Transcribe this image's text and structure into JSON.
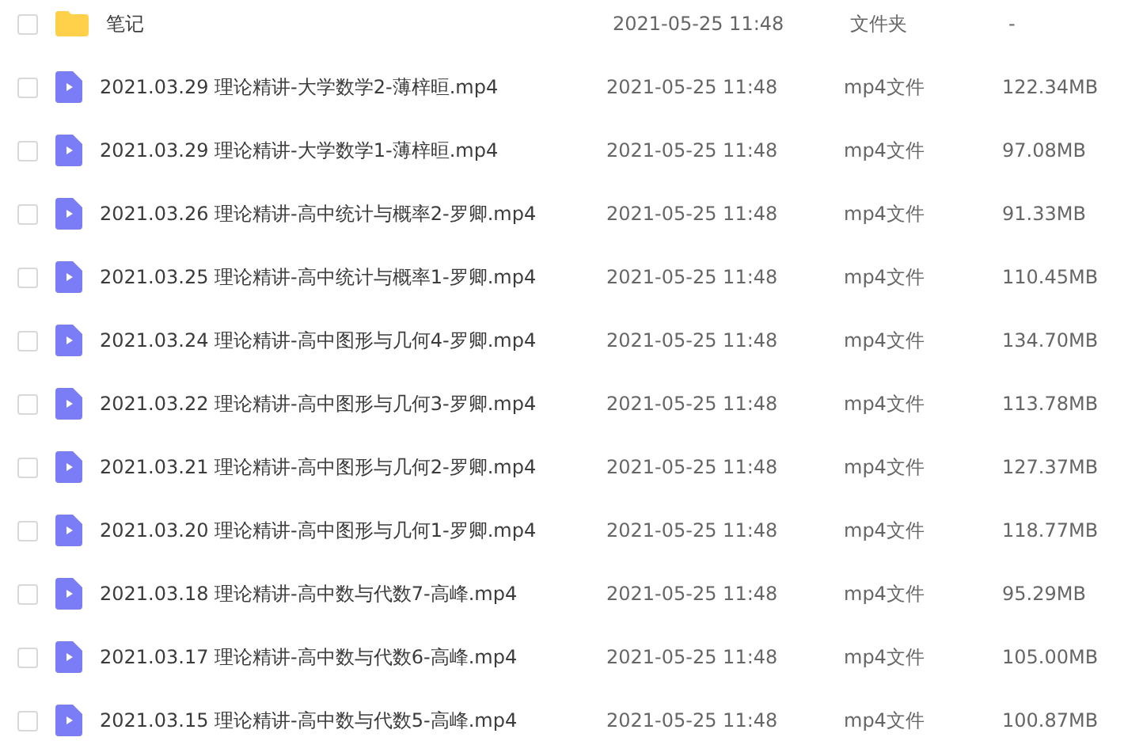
{
  "files": [
    {
      "kind": "folder",
      "checked": false,
      "name": "笔记",
      "modified": "2021-05-25 11:48",
      "type": "文件夹",
      "size": "-"
    },
    {
      "kind": "video",
      "checked": false,
      "name": "2021.03.29 理论精讲-大学数学2-薄梓晅.mp4",
      "modified": "2021-05-25 11:48",
      "type": "mp4文件",
      "size": "122.34MB"
    },
    {
      "kind": "video",
      "checked": false,
      "name": "2021.03.29 理论精讲-大学数学1-薄梓晅.mp4",
      "modified": "2021-05-25 11:48",
      "type": "mp4文件",
      "size": "97.08MB"
    },
    {
      "kind": "video",
      "checked": false,
      "name": "2021.03.26 理论精讲-高中统计与概率2-罗卿.mp4",
      "modified": "2021-05-25 11:48",
      "type": "mp4文件",
      "size": "91.33MB"
    },
    {
      "kind": "video",
      "checked": false,
      "name": "2021.03.25 理论精讲-高中统计与概率1-罗卿.mp4",
      "modified": "2021-05-25 11:48",
      "type": "mp4文件",
      "size": "110.45MB"
    },
    {
      "kind": "video",
      "checked": false,
      "name": "2021.03.24 理论精讲-高中图形与几何4-罗卿.mp4",
      "modified": "2021-05-25 11:48",
      "type": "mp4文件",
      "size": "134.70MB"
    },
    {
      "kind": "video",
      "checked": false,
      "name": "2021.03.22 理论精讲-高中图形与几何3-罗卿.mp4",
      "modified": "2021-05-25 11:48",
      "type": "mp4文件",
      "size": "113.78MB"
    },
    {
      "kind": "video",
      "checked": false,
      "name": "2021.03.21 理论精讲-高中图形与几何2-罗卿.mp4",
      "modified": "2021-05-25 11:48",
      "type": "mp4文件",
      "size": "127.37MB"
    },
    {
      "kind": "video",
      "checked": false,
      "name": "2021.03.20 理论精讲-高中图形与几何1-罗卿.mp4",
      "modified": "2021-05-25 11:48",
      "type": "mp4文件",
      "size": "118.77MB"
    },
    {
      "kind": "video",
      "checked": false,
      "name": "2021.03.18 理论精讲-高中数与代数7-高峰.mp4",
      "modified": "2021-05-25 11:48",
      "type": "mp4文件",
      "size": "95.29MB"
    },
    {
      "kind": "video",
      "checked": false,
      "name": "2021.03.17 理论精讲-高中数与代数6-高峰.mp4",
      "modified": "2021-05-25 11:48",
      "type": "mp4文件",
      "size": "105.00MB"
    },
    {
      "kind": "video",
      "checked": false,
      "name": "2021.03.15 理论精讲-高中数与代数5-高峰.mp4",
      "modified": "2021-05-25 11:48",
      "type": "mp4文件",
      "size": "100.87MB"
    }
  ]
}
